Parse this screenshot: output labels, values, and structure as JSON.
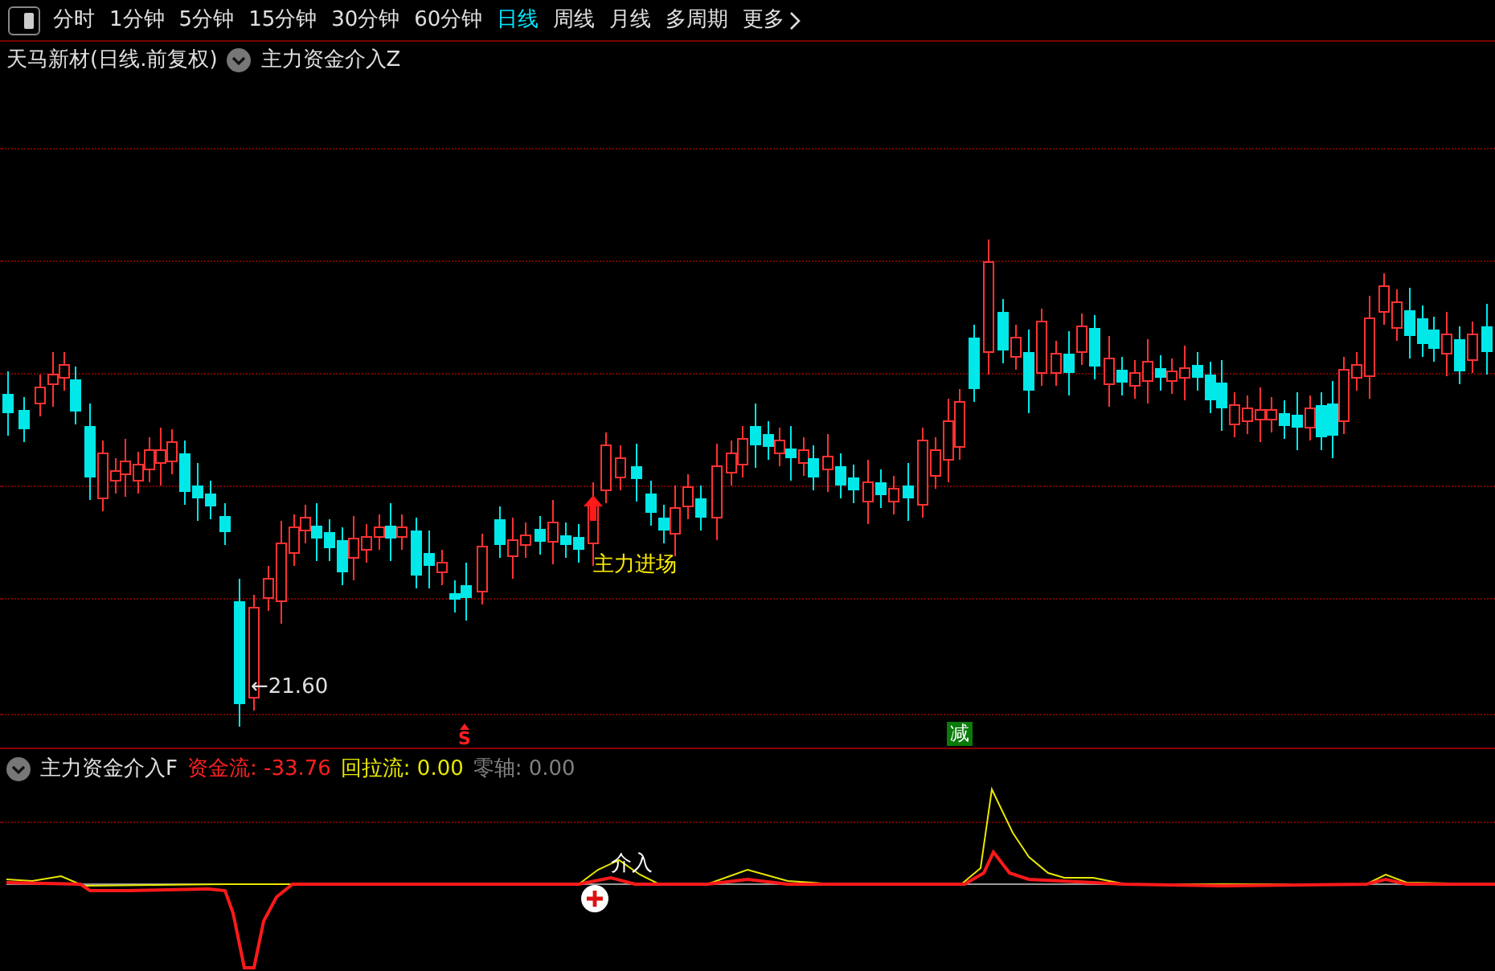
{
  "toolbar": {
    "tabs": [
      {
        "label": "分时",
        "selected": false
      },
      {
        "label": "1分钟",
        "selected": false
      },
      {
        "label": "5分钟",
        "selected": false
      },
      {
        "label": "15分钟",
        "selected": false
      },
      {
        "label": "30分钟",
        "selected": false
      },
      {
        "label": "60分钟",
        "selected": false
      },
      {
        "label": "日线",
        "selected": true
      },
      {
        "label": "周线",
        "selected": false
      },
      {
        "label": "月线",
        "selected": false
      },
      {
        "label": "多周期",
        "selected": false
      }
    ],
    "more": "更多"
  },
  "chart": {
    "title": "天马新材(日线.前复权)",
    "indicator": "主力资金介入Z",
    "low_label": "←21.60",
    "signal_label": "主力进场",
    "markers": [
      {
        "kind": "sell",
        "text": "S"
      },
      {
        "kind": "reduce",
        "text": "减"
      }
    ]
  },
  "indicator_panel": {
    "name": "主力资金介入F",
    "legend": [
      {
        "label": "资金流: -33.76",
        "color": "#ff2020"
      },
      {
        "label": "回拉流: 0.00",
        "color": "#e8e800"
      },
      {
        "label": "零轴: 0.00",
        "color": "#808080"
      }
    ],
    "signal_label": "介入"
  }
}
